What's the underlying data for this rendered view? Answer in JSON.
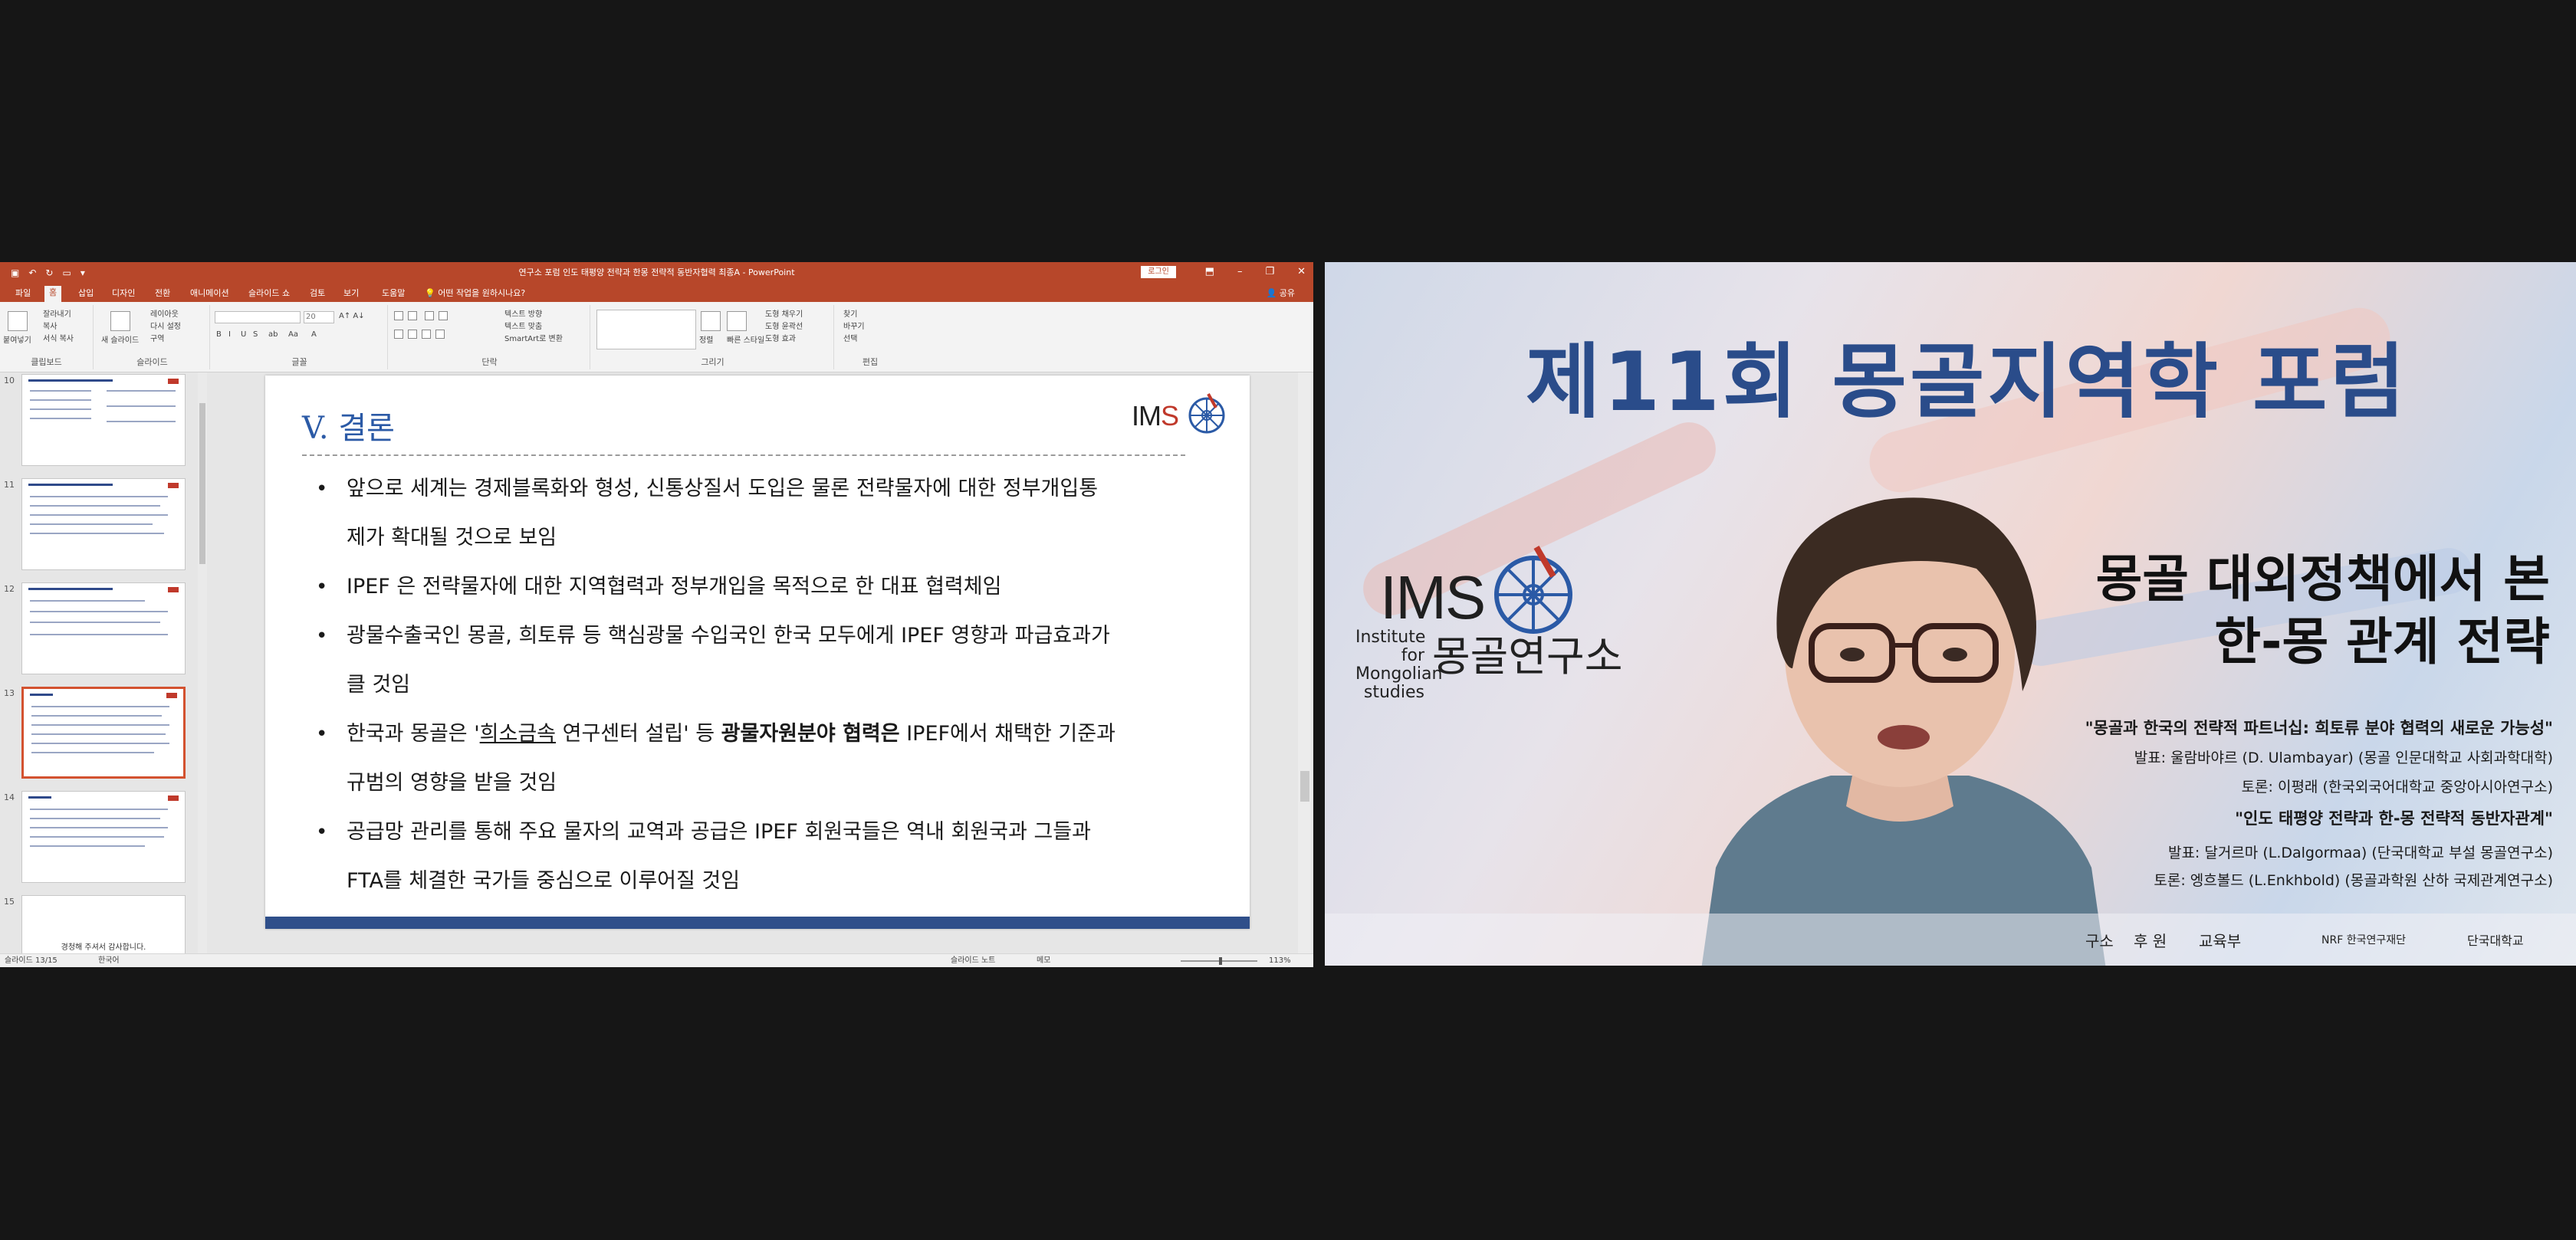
{
  "ppt": {
    "window_title": "연구소 포럼 인도 태평양 전략과 한몽 전략적 동반자협력 최종A - PowerPoint",
    "signin_label": "로그인",
    "window_controls": [
      "⬒",
      "–",
      "❐",
      "✕"
    ],
    "tabs": [
      "파일",
      "홈",
      "삽입",
      "디자인",
      "전환",
      "애니메이션",
      "슬라이드 쇼",
      "검토",
      "보기",
      "도움말"
    ],
    "active_tab": "홈",
    "tell_me": "어떤 작업을 원하시나요?",
    "share_label": "공유",
    "ribbon": {
      "paste": "붙여넣기",
      "cut": "잘라내기",
      "copy": "복사",
      "format_painter": "서식 복사",
      "group_clipboard": "클립보드",
      "new_slide": "새 슬라이드",
      "layout": "레이아웃",
      "reset": "다시 설정",
      "section": "구역",
      "group_slides": "슬라이드",
      "font_size": "20",
      "group_font": "글꼴",
      "text_direction": "텍스트 방향",
      "align_text": "텍스트 맞춤",
      "smartart": "SmartArt로 변환",
      "group_paragraph": "단락",
      "arrange": "정렬",
      "quick_styles": "빠른 스타일",
      "shape_fill": "도형 채우기",
      "shape_outline": "도형 윤곽선",
      "shape_effects": "도형 효과",
      "group_drawing": "그리기",
      "find": "찾기",
      "replace": "바꾸기",
      "select": "선택",
      "group_editing": "편집"
    },
    "thumbnails": [
      {
        "num": "10",
        "end_text": ""
      },
      {
        "num": "11",
        "end_text": ""
      },
      {
        "num": "12",
        "end_text": ""
      },
      {
        "num": "13",
        "end_text": ""
      },
      {
        "num": "14",
        "end_text": ""
      },
      {
        "num": "15",
        "end_text": "경청해 주셔서 감사합니다."
      }
    ],
    "slide": {
      "title": "V. 결론",
      "logo_prefix": "IM",
      "logo_suffix": "S",
      "bullets": [
        {
          "lines": [
            "앞으로 세계는 경제블록화와 형성, 신통상질서 도입은 물론 전략물자에 대한 정부개입통",
            "제가 확대될 것으로 보임"
          ]
        },
        {
          "lines": [
            "IPEF 은 전략물자에 대한 지역협력과 정부개입을 목적으로 한 대표 협력체임"
          ]
        },
        {
          "lines": [
            "광물수출국인 몽골, 희토류 등 핵심광물 수입국인 한국 모두에게 IPEF 영향과 파급효과가",
            "클 것임"
          ]
        },
        {
          "pre": "한국과 몽골은 '",
          "underline": "희소금속",
          "mid": " 연구센터 설립' 등 ",
          "bold": "광물자원분야 협력은",
          "post": " IPEF에서 채택한 기준과",
          "line2": "규범의 영향을 받을 것임"
        },
        {
          "lines": [
            "공급망 관리를 통해 주요 물자의 교역과 공급은 IPEF 회원국들은 역내 회원국과 그들과",
            "FTA를 체결한 국가들 중심으로 이루어질 것임"
          ]
        }
      ]
    },
    "status": {
      "slide_counter": "슬라이드 13/15",
      "language": "한국어",
      "notes": "슬라이드 노트",
      "memo": "메모",
      "zoom": "113%"
    }
  },
  "video": {
    "banner_title": "제11회 몽골지역학 포럼",
    "logo_text": "IMS",
    "institute": [
      "Institute",
      "for",
      "Mongolian",
      "studies"
    ],
    "institute_kr": "몽골연구소",
    "subtitle_line1": "몽골 대외정책에서 본",
    "subtitle_line2": "한-몽 관계 전략",
    "session1_title": "\"몽골과 한국의 전략적 파트너십: 희토류 분야 협력의 새로운 가능성\"",
    "session1_presenter": "발표: 울람바야르 (D. Ulambayar) (몽골 인문대학교 사회과학대학)",
    "session1_discussant": "토론: 이평래 (한국외국어대학교 중앙아시아연구소)",
    "session2_title": "\"인도 태평양 전략과 한-몽 전략적 동반자관계\"",
    "session2_presenter": "발표: 달거르마 (L.Dalgormaa) (단국대학교 부설 몽골연구소)",
    "session2_discussant": "토론: 엥흐볼드 (L.Enkhbold) (몽골과학원 산하 국제관계연구소)",
    "footer_left": "구소",
    "footer_sponsor": "후 원",
    "footer_org1": "교육부",
    "footer_org2": "NRF 한국연구재단",
    "footer_org3": "단국대학교"
  }
}
